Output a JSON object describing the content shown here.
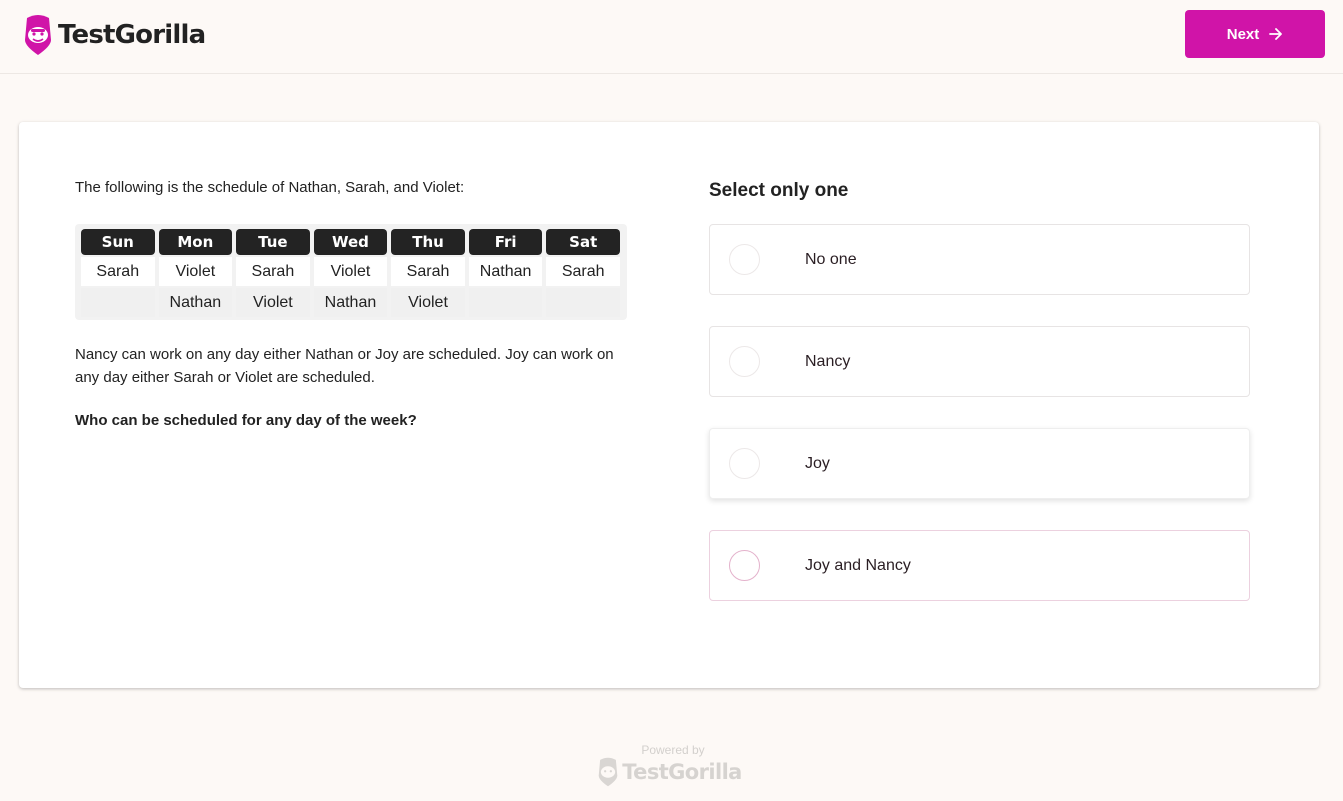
{
  "header": {
    "brand": "TestGorilla",
    "next_label": "Next",
    "brand_color": "#d014a8"
  },
  "question": {
    "intro": "The following is the schedule of Nathan, Sarah, and Violet:",
    "schedule": {
      "days": [
        "Sun",
        "Mon",
        "Tue",
        "Wed",
        "Thu",
        "Fri",
        "Sat"
      ],
      "row1": [
        "Sarah",
        "Violet",
        "Sarah",
        "Violet",
        "Sarah",
        "Nathan",
        "Sarah"
      ],
      "row2": [
        "",
        "Nathan",
        "Violet",
        "Nathan",
        "Violet",
        "",
        ""
      ]
    },
    "body": "Nancy can work on any day either Nathan or Joy are scheduled. Joy can work on any day either Sarah or Violet are scheduled.",
    "prompt": "Who can be scheduled for any day of the week?"
  },
  "answers": {
    "instruction": "Select only one",
    "options": [
      {
        "label": "No one"
      },
      {
        "label": "Nancy"
      },
      {
        "label": "Joy"
      },
      {
        "label": "Joy and Nancy"
      }
    ]
  },
  "footer": {
    "powered_by": "Powered by",
    "brand": "TestGorilla"
  }
}
